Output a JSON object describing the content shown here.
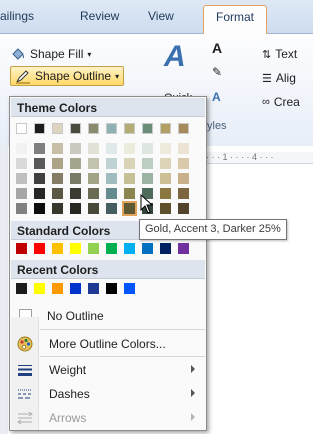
{
  "tabs": [
    {
      "label": "ailings",
      "active": false
    },
    {
      "label": "Review",
      "active": false
    },
    {
      "label": "View",
      "active": false
    },
    {
      "label": "Format",
      "active": true
    }
  ],
  "ribbon": {
    "shape_fill": "Shape Fill",
    "shape_outline": "Shape Outline",
    "quick_partial": "Quick",
    "styles_partial": "yles",
    "text_partial": "Text",
    "align_partial": "Alig",
    "create_partial": "Crea",
    "ruler_mark": "4"
  },
  "menu": {
    "theme_colors_label": "Theme Colors",
    "standard_colors_label": "Standard Colors",
    "recent_colors_label": "Recent Colors",
    "theme_base": [
      "#ffffff",
      "#1c1c1c",
      "#ddd5c0",
      "#4b4b3f",
      "#8a8a6e",
      "#8fb1b4",
      "#b4ad74",
      "#6b8c76",
      "#b19f64",
      "#a68a5a"
    ],
    "theme_tints": [
      [
        "#f2f2f2",
        "#7f7f7f",
        "#c6bea6",
        "#c9c9bf",
        "#e1e1d6",
        "#dfe9e9",
        "#ececdc",
        "#dde6df",
        "#eeeadc",
        "#ede3d5"
      ],
      [
        "#d9d9d9",
        "#595959",
        "#aba287",
        "#a6a68f",
        "#c2c2ae",
        "#bfd2d3",
        "#d9d4b8",
        "#bccdc1",
        "#ddd4b8",
        "#dbc9ac"
      ],
      [
        "#bfbfbf",
        "#3f3f3f",
        "#857c65",
        "#7a7a66",
        "#a3a385",
        "#a0bcbf",
        "#c6c096",
        "#9ab3a3",
        "#ccbf96",
        "#c9b08a"
      ],
      [
        "#a6a6a6",
        "#262626",
        "#5c5644",
        "#3b3b31",
        "#6c6c54",
        "#668b8f",
        "#8b8550",
        "#4e6a58",
        "#8b7841",
        "#7d6540"
      ],
      [
        "#808080",
        "#0d0d0d",
        "#38352a",
        "#272721",
        "#484838",
        "#445d60",
        "#5d5935",
        "#34463a",
        "#5d502b",
        "#53432b"
      ]
    ],
    "selected_swatch": {
      "row": 4,
      "col": 6
    },
    "standard_colors": [
      "#c00000",
      "#ff0000",
      "#ffc000",
      "#ffff00",
      "#92d050",
      "#00b050",
      "#00b0f0",
      "#0070c0",
      "#002060",
      "#7030a0"
    ],
    "recent_colors": [
      "#1c1c1c",
      "#ffff00",
      "#ff9900",
      "#0033cc",
      "#1f3a93",
      "#000000",
      "#0055ff"
    ],
    "no_outline": "No Outline",
    "more_colors": "More Outline Colors...",
    "weight": "Weight",
    "dashes": "Dashes",
    "arrows": "Arrows",
    "tooltip": "Gold, Accent 3, Darker 25%",
    "colors": {
      "highlight_fill": "#ffd867",
      "highlight_border": "#e2a45c",
      "header_bg": "#dde4ee"
    }
  }
}
